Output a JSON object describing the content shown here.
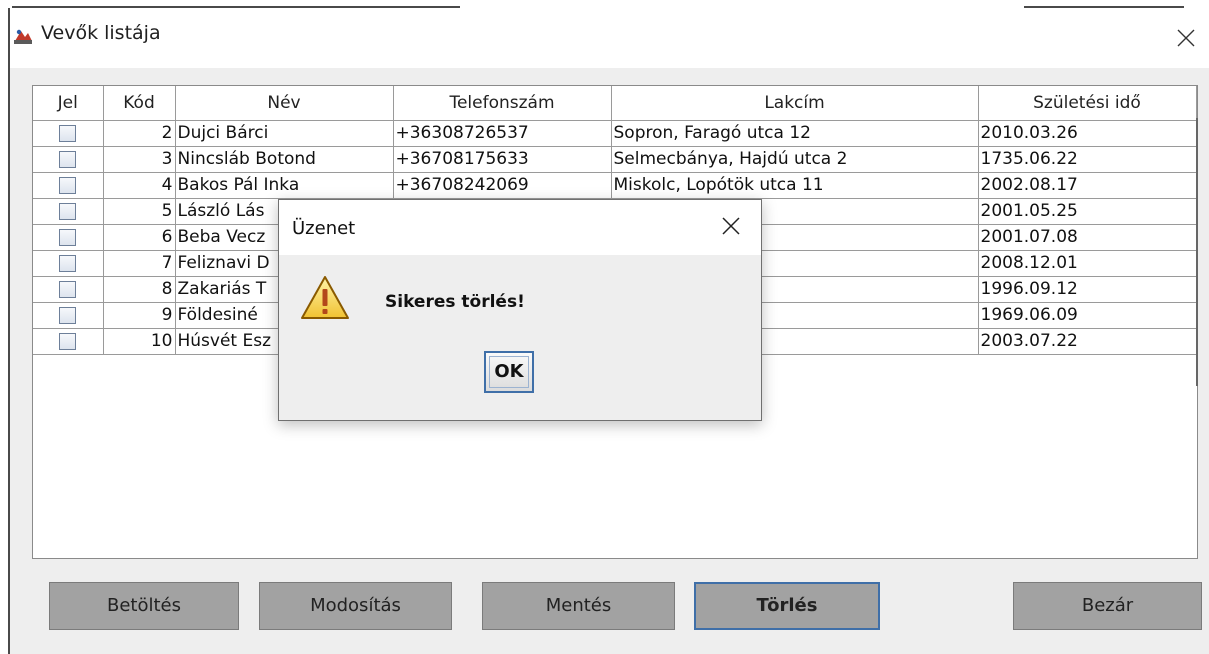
{
  "window": {
    "title": "Vevők listája",
    "icon": "java-app-icon",
    "close_icon": "close-icon"
  },
  "table": {
    "columns": [
      "Jel",
      "Kód",
      "Név",
      "Telefonszám",
      "Lakcím",
      "Születési idő"
    ],
    "rows": [
      {
        "jel": false,
        "kod": "2",
        "nev": "Dujci Bárci",
        "telefon": "+36308726537",
        "lakcim": "Sopron, Faragó utca 12",
        "szul": "2010.03.26"
      },
      {
        "jel": false,
        "kod": "3",
        "nev": "Nincsláb Botond",
        "telefon": "+36708175633",
        "lakcim": "Selmecbánya, Hajdú utca 2",
        "szul": "1735.06.22"
      },
      {
        "jel": false,
        "kod": "4",
        "nev": "Bakos Pál Inka",
        "telefon": "+36708242069",
        "lakcim": "Miskolc, Lopótök utca 11",
        "szul": "2002.08.17"
      },
      {
        "jel": false,
        "kod": "5",
        "nev": "László Lás",
        "telefon": "",
        "lakcim": "a utca 24/A",
        "szul": "2001.05.25"
      },
      {
        "jel": false,
        "kod": "6",
        "nev": "Beba Vecz",
        "telefon": "",
        "lakcim": "end út 6",
        "szul": "2001.07.08"
      },
      {
        "jel": false,
        "kod": "7",
        "nev": "Feliznavi D",
        "telefon": "",
        "lakcim": "út 34",
        "szul": "2008.12.01"
      },
      {
        "jel": false,
        "kod": "8",
        "nev": "Zakariás T",
        "telefon": "",
        "lakcim": "t utca 8",
        "szul": "1996.09.12"
      },
      {
        "jel": false,
        "kod": "9",
        "nev": "Földesiné",
        "telefon": "",
        "lakcim": "öz 7",
        "szul": "1969.06.09"
      },
      {
        "jel": false,
        "kod": "10",
        "nev": "Húsvét Esz",
        "telefon": "",
        "lakcim": "iom utca 43",
        "szul": "2003.07.22"
      }
    ]
  },
  "buttons": {
    "load": "Betöltés",
    "modify": "Modosítás",
    "save": "Mentés",
    "delete": "Törlés",
    "close": "Bezár"
  },
  "dialog": {
    "title": "Üzenet",
    "message": "Sikeres törlés!",
    "ok_label": "OK",
    "icon": "warning-icon"
  }
}
